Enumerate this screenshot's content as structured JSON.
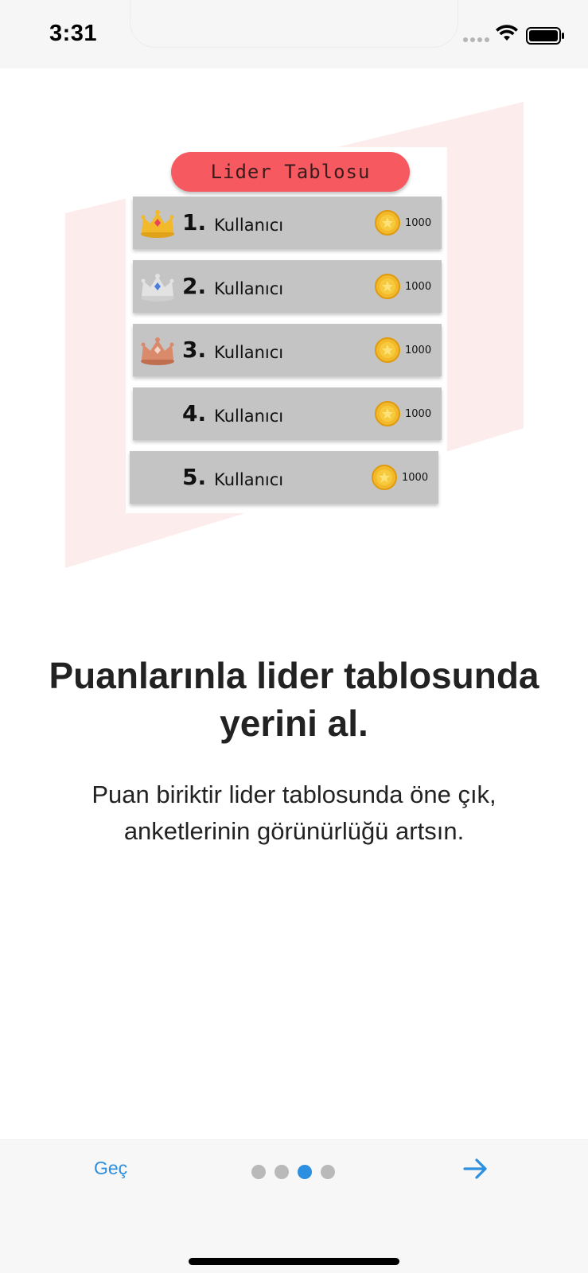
{
  "status_bar": {
    "time": "3:31"
  },
  "leaderboard": {
    "title": "Lider Tablosu",
    "rows": [
      {
        "rank": "1.",
        "name": "Kullanıcı",
        "score": "1000",
        "crown": "gold-crown-icon"
      },
      {
        "rank": "2.",
        "name": "Kullanıcı",
        "score": "1000",
        "crown": "silver-crown-icon"
      },
      {
        "rank": "3.",
        "name": "Kullanıcı",
        "score": "1000",
        "crown": "bronze-crown-icon"
      },
      {
        "rank": "4.",
        "name": "Kullanıcı",
        "score": "1000",
        "crown": ""
      },
      {
        "rank": "5.",
        "name": "Kullanıcı",
        "score": "1000",
        "crown": ""
      }
    ]
  },
  "onboarding": {
    "headline": "Puanlarınla lider tablosunda yerini al.",
    "description": "Puan biriktir lider tablosunda öne çık, anketlerinin görünürlüğü artsın."
  },
  "navigation": {
    "skip_label": "Geç",
    "page_count": 4,
    "current_page": 3,
    "next_icon": "arrow-right-icon"
  },
  "colors": {
    "accent": "#2d8fe0",
    "title_pill": "#f65a60",
    "row_bg": "#c4c4c4",
    "pink_bg": "#fdecec",
    "gold": "#f2b92a",
    "silver": "#e2e2e2",
    "bronze": "#d98a6a"
  }
}
